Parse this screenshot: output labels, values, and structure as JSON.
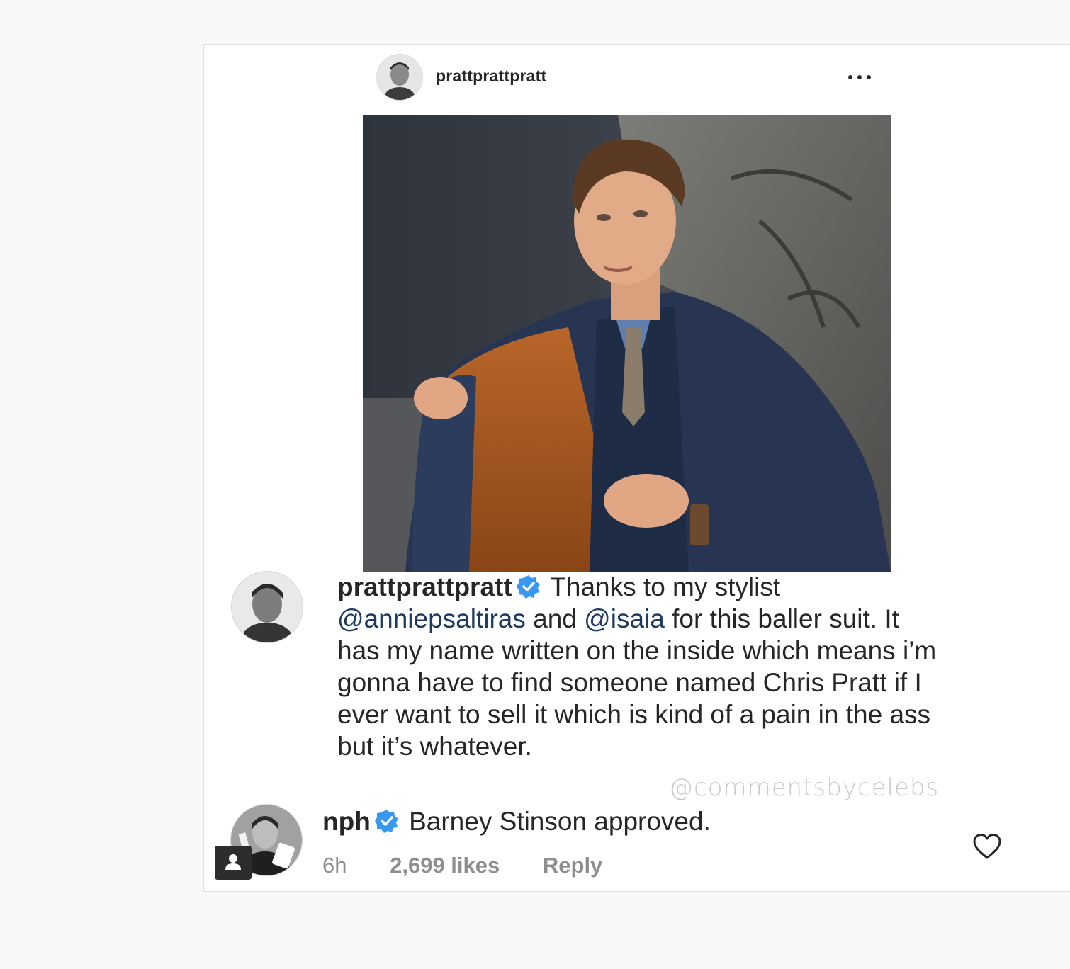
{
  "post": {
    "username": "prattprattpratt",
    "more_icon": "more-horizontal-icon",
    "photo_subject": "photo"
  },
  "caption": {
    "username": "prattprattpratt",
    "verified_icon": "verified-badge-icon",
    "text_before_mention1": "Thanks to my stylist",
    "mention1": "@anniepsaltiras",
    "text_between_mentions": "and",
    "mention2": "@isaia",
    "text_after_mentions": "for this baller suit. It has my name written on the inside which means i’m gonna have to find someone named Chris Pratt if I ever want to sell it which is kind of a pain in the ass but it’s whatever."
  },
  "watermark": "@commentsbycelebs",
  "reply": {
    "username": "nph",
    "verified_icon": "verified-badge-icon",
    "text": "Barney Stinson approved.",
    "time": "6h",
    "likes": "2,699 likes",
    "reply_label": "Reply",
    "heart_icon": "heart-outline-icon"
  },
  "colors": {
    "verified": "#3897f0",
    "mention": "#1e3a5f",
    "meta_text": "#8e8e8e",
    "watermark": "#c9c9c9"
  }
}
